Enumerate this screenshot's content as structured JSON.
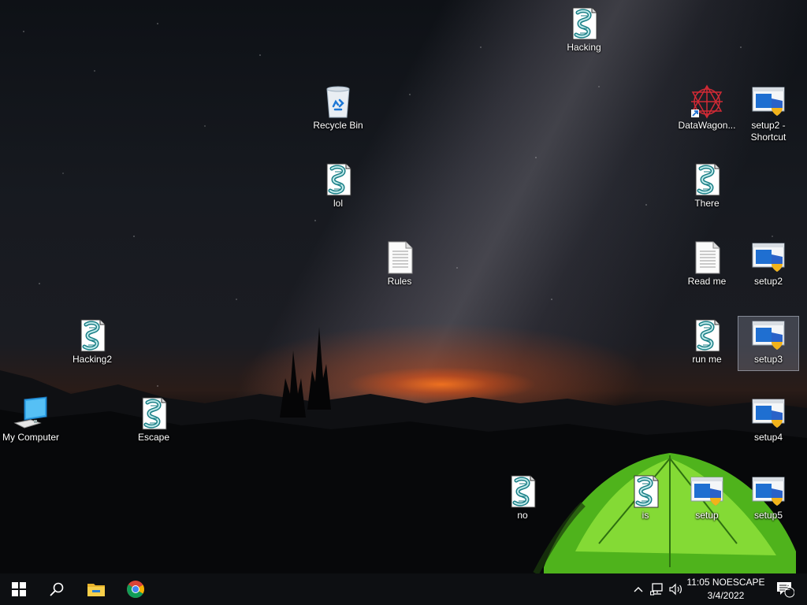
{
  "desktop": {
    "icons": [
      {
        "label": "Hacking",
        "icon": "script-icon"
      },
      {
        "label": "Recycle Bin",
        "icon": "recycle-bin-icon"
      },
      {
        "label": "DataWagon...",
        "icon": "datawagon-shortcut-icon"
      },
      {
        "label": "setup2 - Shortcut",
        "icon": "setup-installer-icon"
      },
      {
        "label": "lol",
        "icon": "script-icon"
      },
      {
        "label": "There",
        "icon": "script-icon"
      },
      {
        "label": "Rules",
        "icon": "text-file-icon"
      },
      {
        "label": "Read me",
        "icon": "text-file-icon"
      },
      {
        "label": "setup2",
        "icon": "setup-installer-icon"
      },
      {
        "label": "Hacking2",
        "icon": "script-icon"
      },
      {
        "label": "run me",
        "icon": "script-icon"
      },
      {
        "label": "setup3",
        "icon": "setup-installer-icon",
        "selected": true
      },
      {
        "label": "My Computer",
        "icon": "computer-icon"
      },
      {
        "label": "Escape",
        "icon": "script-icon"
      },
      {
        "label": "setup4",
        "icon": "setup-installer-icon"
      },
      {
        "label": "no",
        "icon": "script-icon"
      },
      {
        "label": "is",
        "icon": "script-icon"
      },
      {
        "label": "setup",
        "icon": "setup-installer-icon"
      },
      {
        "label": "setup5",
        "icon": "setup-installer-icon"
      }
    ]
  },
  "taskbar": {
    "start": "windows-start-icon",
    "search": "search-icon",
    "pinned": [
      "file-explorer-icon",
      "chrome-icon"
    ],
    "tray": {
      "chevron": "chevron-up-icon",
      "network": "network-icon",
      "volume": "volume-icon",
      "time": "11:05 NOESCAPE",
      "date": "3/4/2022",
      "notifications": "notification-icon",
      "notification_count": "2"
    }
  }
}
